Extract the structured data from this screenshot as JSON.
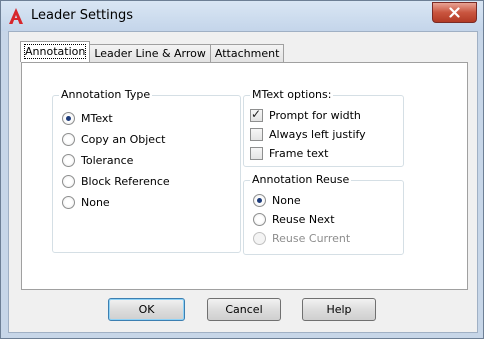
{
  "window": {
    "title": "Leader Settings",
    "close_icon": "close-icon"
  },
  "tabs": [
    {
      "label": "Annotation",
      "active": true
    },
    {
      "label": "Leader Line & Arrow",
      "active": false
    },
    {
      "label": "Attachment",
      "active": false
    }
  ],
  "annotation_type": {
    "title": "Annotation Type",
    "options": [
      {
        "label": "MText",
        "selected": true
      },
      {
        "label": "Copy an Object",
        "selected": false
      },
      {
        "label": "Tolerance",
        "selected": false
      },
      {
        "label": "Block Reference",
        "selected": false
      },
      {
        "label": "None",
        "selected": false
      }
    ]
  },
  "mtext_options": {
    "title": "MText options:",
    "options": [
      {
        "label": "Prompt for width",
        "checked": true
      },
      {
        "label": "Always left justify",
        "checked": false
      },
      {
        "label": "Frame text",
        "checked": false
      }
    ]
  },
  "annotation_reuse": {
    "title": "Annotation Reuse",
    "options": [
      {
        "label": "None",
        "selected": true,
        "enabled": true
      },
      {
        "label": "Reuse Next",
        "selected": false,
        "enabled": true
      },
      {
        "label": "Reuse Current",
        "selected": false,
        "enabled": false
      }
    ]
  },
  "buttons": {
    "ok": "OK",
    "cancel": "Cancel",
    "help": "Help"
  },
  "colors": {
    "accent": "#3c7fb1",
    "close": "#c9553f"
  }
}
